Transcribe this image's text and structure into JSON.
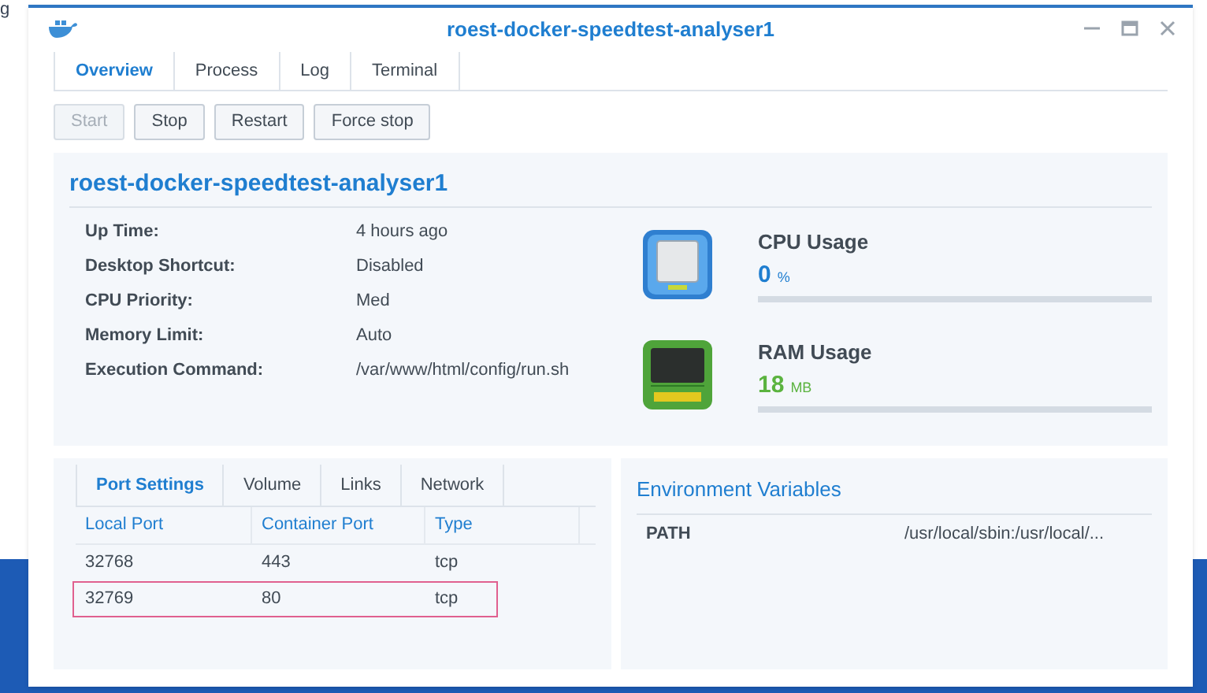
{
  "desktop": {
    "fragment": "g"
  },
  "window": {
    "title": "roest-docker-speedtest-analyser1"
  },
  "tabs": [
    {
      "label": "Overview",
      "selected": true
    },
    {
      "label": "Process",
      "selected": false
    },
    {
      "label": "Log",
      "selected": false
    },
    {
      "label": "Terminal",
      "selected": false
    }
  ],
  "buttons": [
    {
      "label": "Start",
      "disabled": true
    },
    {
      "label": "Stop",
      "disabled": false
    },
    {
      "label": "Restart",
      "disabled": false
    },
    {
      "label": "Force stop",
      "disabled": false
    }
  ],
  "overview": {
    "title": "roest-docker-speedtest-analyser1",
    "fields": [
      {
        "label": "Up Time:",
        "value": "4 hours ago"
      },
      {
        "label": "Desktop Shortcut:",
        "value": "Disabled"
      },
      {
        "label": "CPU Priority:",
        "value": "Med"
      },
      {
        "label": "Memory Limit:",
        "value": "Auto"
      },
      {
        "label": "Execution Command:",
        "value": "/var/www/html/config/run.sh"
      }
    ],
    "meters": [
      {
        "kind": "cpu",
        "title": "CPU Usage",
        "value": "0",
        "unit": "%",
        "level": 0
      },
      {
        "kind": "ram",
        "title": "RAM Usage",
        "value": "18",
        "unit": "MB",
        "level": 0
      }
    ]
  },
  "port_panel": {
    "tabs": [
      {
        "label": "Port Settings",
        "selected": true
      },
      {
        "label": "Volume",
        "selected": false
      },
      {
        "label": "Links",
        "selected": false
      },
      {
        "label": "Network",
        "selected": false
      }
    ],
    "columns": [
      "Local Port",
      "Container Port",
      "Type"
    ],
    "rows": [
      {
        "cells": [
          "32768",
          "443",
          "tcp"
        ],
        "highlighted": false
      },
      {
        "cells": [
          "32769",
          "80",
          "tcp"
        ],
        "highlighted": true
      }
    ]
  },
  "env_panel": {
    "title": "Environment Variables",
    "rows": [
      {
        "name": "PATH",
        "value": "/usr/local/sbin:/usr/local/..."
      }
    ]
  }
}
